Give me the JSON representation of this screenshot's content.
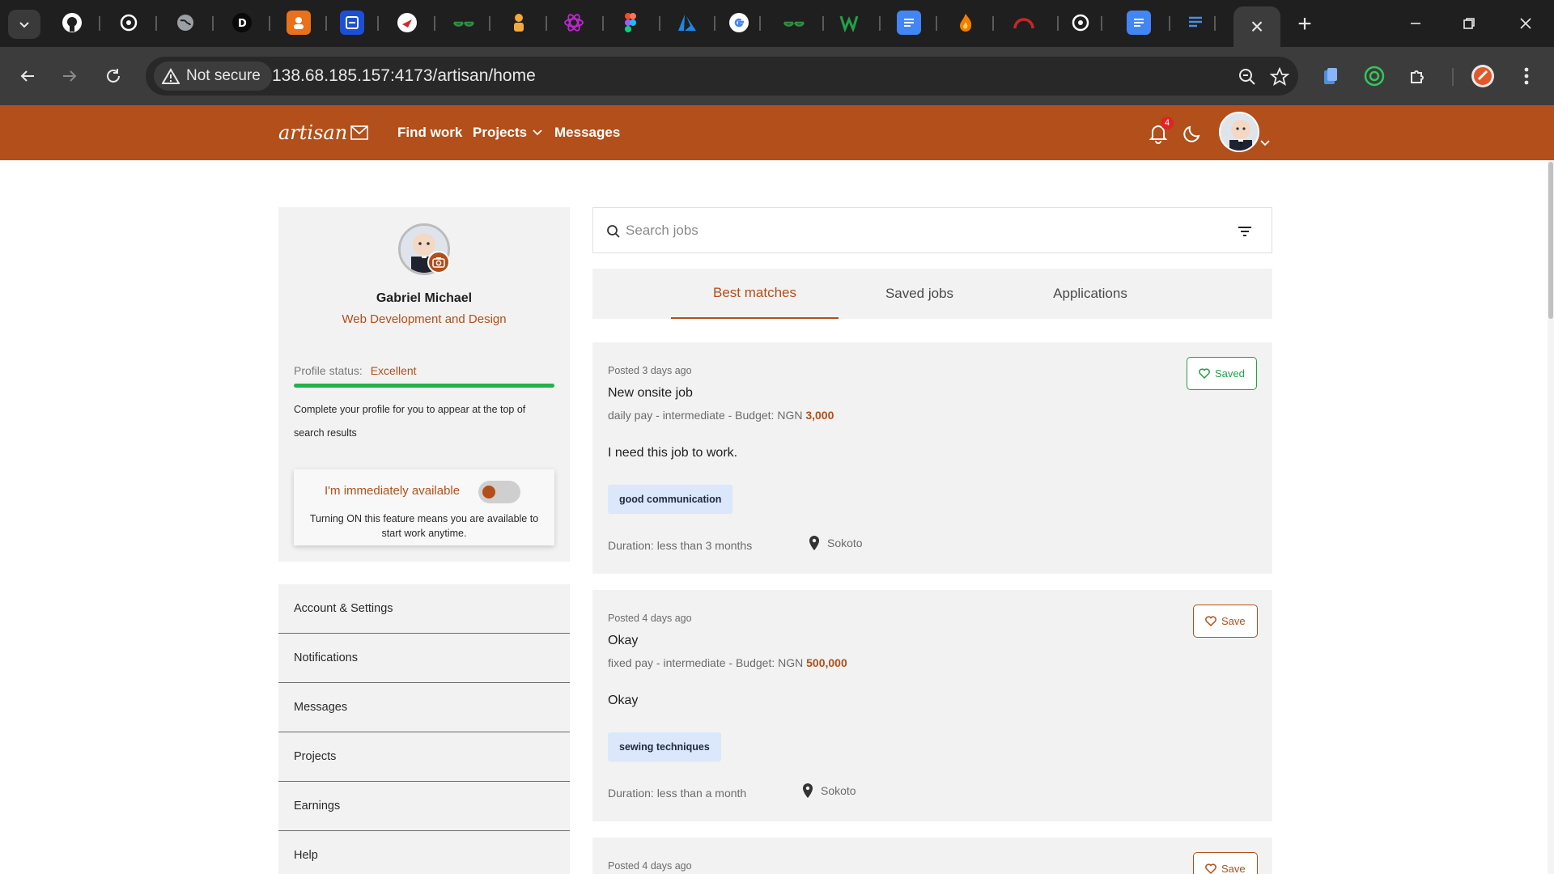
{
  "browser": {
    "active_tab_close": "×",
    "new_tab": "+",
    "not_secure_label": "Not secure",
    "url": "138.68.185.157:4173/artisan/home"
  },
  "header": {
    "logo_text": "artisan",
    "nav": {
      "find_work": "Find work",
      "projects": "Projects",
      "messages": "Messages"
    },
    "notification_count": "4"
  },
  "profile": {
    "name": "Gabriel Michael",
    "title": "Web Development and Design",
    "status_label": "Profile status:",
    "status_value": "Excellent",
    "progress": 1.0,
    "complete_note": "Complete your profile for you to appear at the top of search results",
    "availability_label": "I'm immediately available",
    "availability_on": false,
    "availability_note": "Turning ON this feature means you are available to start work anytime."
  },
  "menu": [
    "Account & Settings",
    "Notifications",
    "Messages",
    "Projects",
    "Earnings",
    "Help"
  ],
  "search": {
    "placeholder": "Search jobs"
  },
  "tabs": [
    "Best matches",
    "Saved jobs",
    "Applications"
  ],
  "jobs": [
    {
      "posted": "Posted 3 days ago",
      "title": "New onsite job",
      "meta": "daily pay - intermediate - Budget: NGN",
      "budget": "3,000",
      "description": "I need this job to work.",
      "skill": "good communication",
      "duration": "Duration: less than 3 months",
      "location": "Sokoto",
      "save_label": "Saved"
    },
    {
      "posted": "Posted 4 days ago",
      "title": "Okay",
      "meta": "fixed pay - intermediate - Budget: NGN",
      "budget": "500,000",
      "description": "Okay",
      "skill": "sewing techniques",
      "duration": "Duration: less than a month",
      "location": "Sokoto",
      "save_label": "Save"
    },
    {
      "posted": "Posted 4 days ago",
      "save_label": "Save"
    }
  ],
  "colors": {
    "brand": "#b24f1a",
    "saved_green": "#22a04a",
    "progress_green": "#22b24c",
    "tag_blue": "#dbe7fb"
  }
}
